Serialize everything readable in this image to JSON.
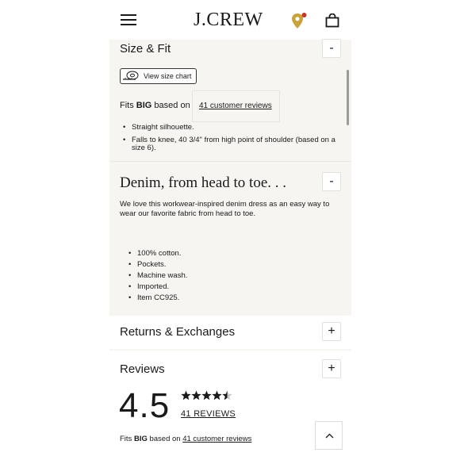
{
  "header": {
    "logo": "J.CREW",
    "menu_icon": "hamburger-menu-icon",
    "store_icon": "location-pin-icon",
    "bag_icon": "shopping-bag-icon",
    "accent": "#c8a23a",
    "badge_color": "#c0392b"
  },
  "size_fit": {
    "title": "Size & Fit",
    "toggle": "-",
    "size_chart_label": "View size chart",
    "fits_prefix": "Fits",
    "fits_value": "BIG",
    "fits_middle": "based on",
    "reviews_link": "41 customer reviews",
    "bullets": [
      "Straight silhouette.",
      "Falls to knee, 40 3/4\" from high point of shoulder (based on a size 6)."
    ]
  },
  "denim": {
    "title": "Denim, from head to toe. . .",
    "toggle": "-",
    "description": "We love this workwear-inspired denim dress as an easy way to wear our favorite fabric from head to toe.",
    "bullets": [
      "100% cotton.",
      "Pockets.",
      "Machine wash.",
      "Imported.",
      "Item CC925."
    ]
  },
  "returns": {
    "title": "Returns & Exchanges",
    "toggle": "+"
  },
  "reviews": {
    "title": "Reviews",
    "toggle": "+",
    "rating": "4.5",
    "stars": 4.5,
    "count_label": "41 REVIEWS",
    "fits_prefix": "Fits",
    "fits_value": "BIG",
    "fits_middle": "based on",
    "reviews_link": "41 customer reviews"
  },
  "back_to_top_icon": "chevron-up-icon"
}
